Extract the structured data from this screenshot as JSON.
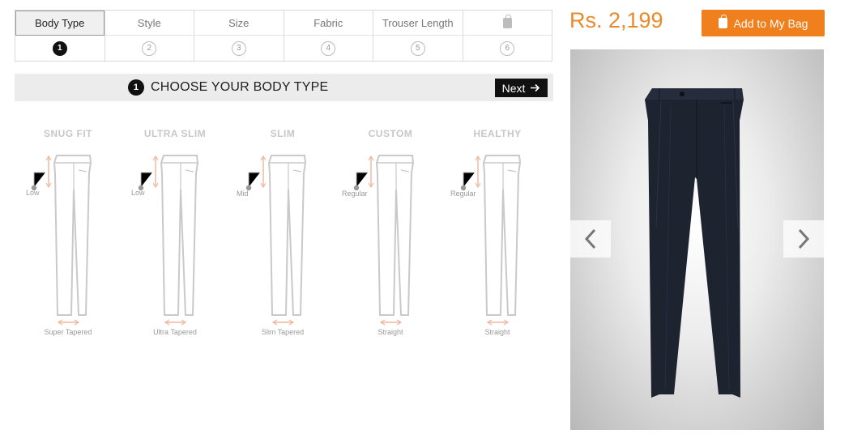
{
  "steps": [
    {
      "label": "Body Type",
      "num": "1"
    },
    {
      "label": "Style",
      "num": "2"
    },
    {
      "label": "Size",
      "num": "3"
    },
    {
      "label": "Fabric",
      "num": "4"
    },
    {
      "label": "Trouser Length",
      "num": "5"
    },
    {
      "label": "",
      "icon": "bag-icon",
      "num": "6"
    }
  ],
  "active_step": 1,
  "section": {
    "number": "1",
    "title": "CHOOSE YOUR BODY TYPE",
    "next_label": "Next"
  },
  "body_types": [
    {
      "name": "SNUG FIT",
      "rise": "Low",
      "hem": "Super Tapered"
    },
    {
      "name": "ULTRA SLIM",
      "rise": "Low",
      "hem": "Ultra Tapered"
    },
    {
      "name": "SLIM",
      "rise": "Mid",
      "hem": "Slim Tapered"
    },
    {
      "name": "CUSTOM",
      "rise": "Regular",
      "hem": "Straight"
    },
    {
      "name": "HEALTHY",
      "rise": "Regular",
      "hem": "Straight"
    }
  ],
  "product": {
    "price": "Rs. 2,199",
    "add_to_bag_label": "Add to My Bag"
  },
  "icons": {
    "prev": "chevron-left-icon",
    "next": "chevron-right-icon",
    "next_button": "arrow-right-icon"
  },
  "colors": {
    "accent": "#f07f1e",
    "price": "#e88a2c",
    "trouser": "#1e2330",
    "annotation": "#f0b59a"
  }
}
